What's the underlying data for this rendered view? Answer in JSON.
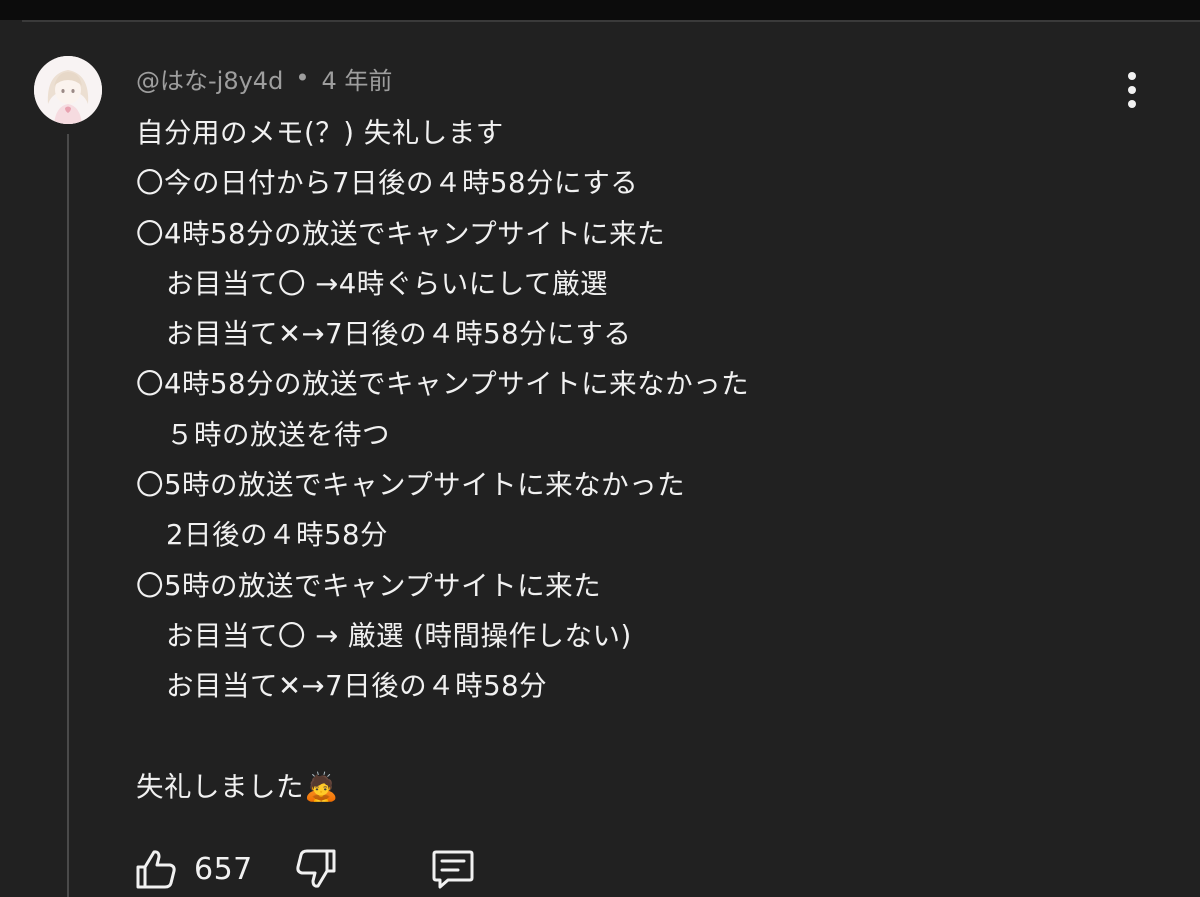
{
  "comment": {
    "author": "@はな-j8y4d",
    "separator": "•",
    "timestamp": "4 年前",
    "lines": [
      "自分用のメモ(？) 失礼します",
      "〇今の日付から7日後の４時58分にする",
      "〇4時58分の放送でキャンプサイトに来た",
      "お目当て〇 →4時ぐらいにして厳選",
      "お目当て✕→7日後の４時58分にする",
      "〇4時58分の放送でキャンプサイトに来なかった",
      "５時の放送を待つ",
      "〇5時の放送でキャンプサイトに来なかった",
      "2日後の４時58分",
      "〇5時の放送でキャンプサイトに来た",
      "お目当て〇 → 厳選 (時間操作しない)",
      "お目当て✕→7日後の４時58分",
      "",
      "失礼しました🙇"
    ]
  },
  "actions": {
    "like_icon": "thumbs-up-icon",
    "like_count": "657",
    "dislike_icon": "thumbs-down-icon",
    "reply_icon": "comment-icon"
  },
  "colors": {
    "background": "#212121",
    "text": "#f1f1f1",
    "meta_text": "#9e9e9e",
    "thread_line": "#4a4a4a"
  }
}
